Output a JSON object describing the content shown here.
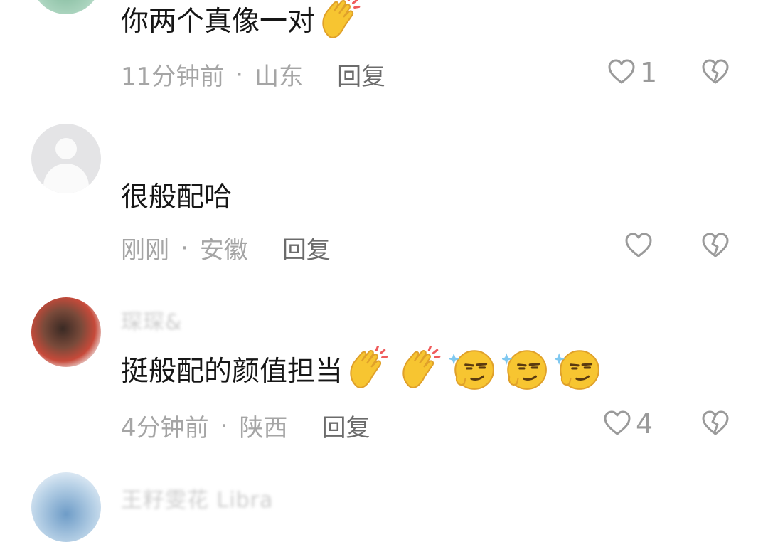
{
  "comments": [
    {
      "username": "",
      "avatar": "avatar-green",
      "text": "你两个真像一对",
      "emojis": [
        "clapping-hands"
      ],
      "time": "11分钟前",
      "location": "山东",
      "reply_label": "回复",
      "like_count": "1"
    },
    {
      "username": "",
      "avatar": "default-avatar",
      "text": "很般配哈",
      "emojis": [],
      "time": "刚刚",
      "location": "安徽",
      "reply_label": "回复",
      "like_count": ""
    },
    {
      "username": "琛琛&",
      "avatar": "avatar-photo",
      "text": "挺般配的颜值担当",
      "emojis": [
        "clapping-hands",
        "clapping-hands",
        "smirk-face",
        "smirk-face",
        "smirk-face"
      ],
      "time": "4分钟前",
      "location": "陕西",
      "reply_label": "回复",
      "like_count": "4"
    },
    {
      "username": "王籽雯花 Libra",
      "avatar": "avatar-blue"
    }
  ],
  "separator": "·",
  "icons": {
    "like": "heart-outline-icon",
    "dislike": "broken-heart-icon"
  },
  "colors": {
    "text": "#161616",
    "meta": "#a5a5a5",
    "reply": "#6b6b6b",
    "icon": "#9a9a9a",
    "emoji_yellow": "#f7c531"
  }
}
